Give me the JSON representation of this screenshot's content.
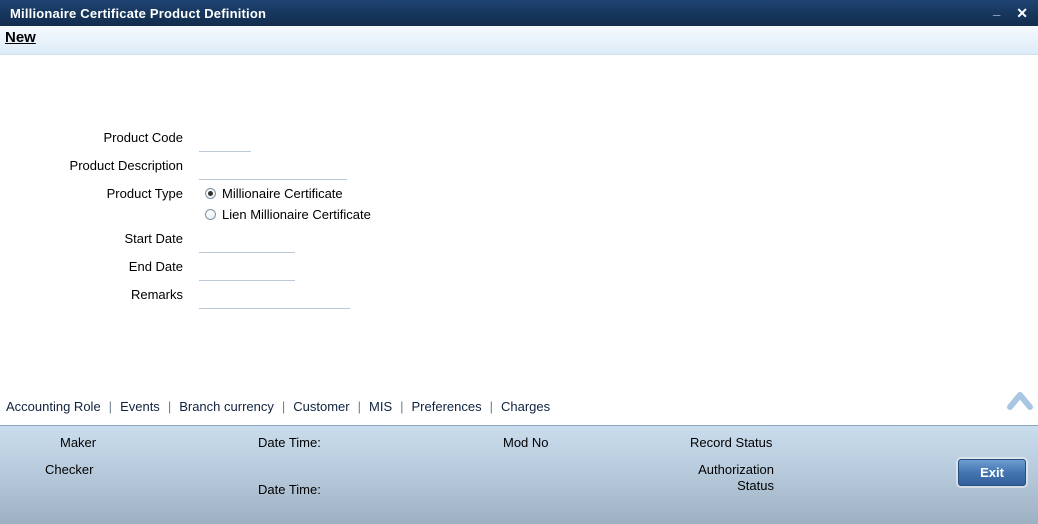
{
  "window": {
    "title": "Millionaire Certificate Product Definition",
    "minimize_icon": "_",
    "close_icon": "✕"
  },
  "actions": {
    "new_label": "New"
  },
  "form": {
    "product_code": {
      "label": "Product Code",
      "value": ""
    },
    "product_description": {
      "label": "Product Description",
      "value": ""
    },
    "product_type": {
      "label": "Product Type",
      "options": [
        {
          "label": "Millionaire Certificate",
          "selected": true
        },
        {
          "label": "Lien Millionaire Certificate",
          "selected": false
        }
      ]
    },
    "start_date": {
      "label": "Start Date",
      "value": ""
    },
    "end_date": {
      "label": "End Date",
      "value": ""
    },
    "remarks": {
      "label": "Remarks",
      "value": ""
    }
  },
  "tabs": {
    "separator": "|",
    "items": [
      {
        "label": "Accounting Role"
      },
      {
        "label": "Events"
      },
      {
        "label": "Branch currency"
      },
      {
        "label": "Customer"
      },
      {
        "label": "MIS"
      },
      {
        "label": "Preferences"
      },
      {
        "label": "Charges"
      }
    ]
  },
  "footer": {
    "maker_label": "Maker",
    "checker_label": "Checker",
    "date_time_label_1": "Date Time:",
    "date_time_label_2": "Date Time:",
    "mod_no_label": "Mod No",
    "record_status_label": "Record Status",
    "authorization_status_label": "Authorization Status",
    "exit_label": "Exit"
  },
  "colors": {
    "titlebar": "#16365c",
    "accent": "#4476b1",
    "footer_top": "#cadded",
    "footer_bottom": "#9db0c1",
    "chevron": "#a9c6e2"
  }
}
